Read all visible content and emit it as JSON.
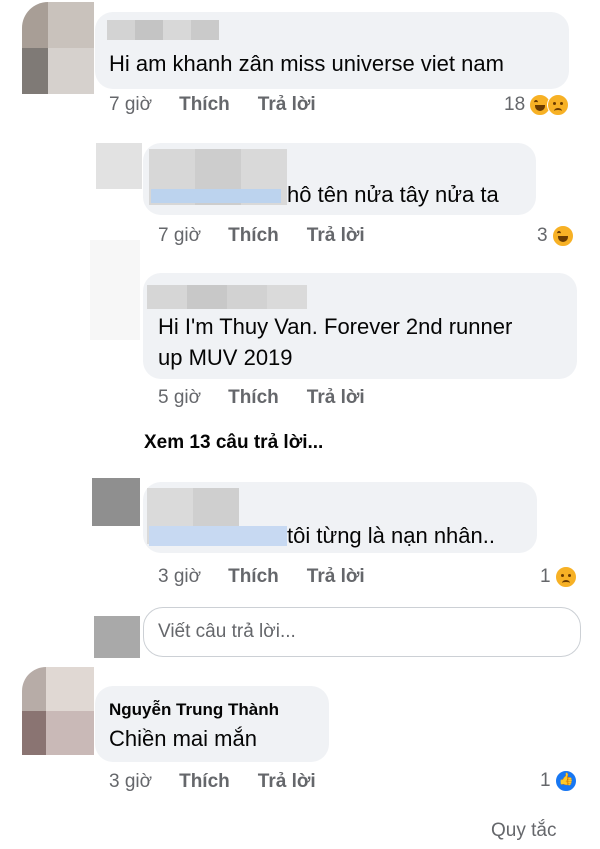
{
  "comments": [
    {
      "text": "Hi am khanh zân miss universe viet nam",
      "time": "7 giờ",
      "like_label": "Thích",
      "reply_label": "Trả lời",
      "reaction_count": "18",
      "reactions": [
        "haha-icon",
        "sad-icon"
      ]
    },
    {
      "text": "hô tên nửa tây nửa ta",
      "time": "7 giờ",
      "like_label": "Thích",
      "reply_label": "Trả lời",
      "reaction_count": "3",
      "reactions": [
        "haha-icon"
      ]
    },
    {
      "text_line1": "Hi I'm Thuy Van. Forever 2nd runner",
      "text_line2": "up MUV 2019",
      "time": "5 giờ",
      "like_label": "Thích",
      "reply_label": "Trả lời"
    },
    {
      "text": "tôi từng là nạn nhân..",
      "time": "3 giờ",
      "like_label": "Thích",
      "reply_label": "Trả lời",
      "reaction_count": "1",
      "reactions": [
        "sad-icon"
      ]
    },
    {
      "author": "Nguyễn Trung Thành",
      "text": "Chiền mai mắn",
      "time": "3 giờ",
      "like_label": "Thích",
      "reply_label": "Trả lời",
      "reaction_count": "1",
      "reactions": [
        "like-icon"
      ]
    }
  ],
  "view_more_replies": "Xem 13 câu trả lời...",
  "reply_input": {
    "placeholder": "Viết câu trả lời..."
  },
  "footer": {
    "rules_link": "Quy tắc"
  },
  "colors": {
    "bubble": "#f0f2f5",
    "meta_text": "#65676b",
    "primary_text": "#050505",
    "haha": "#f7b125",
    "like": "#1877f2"
  }
}
